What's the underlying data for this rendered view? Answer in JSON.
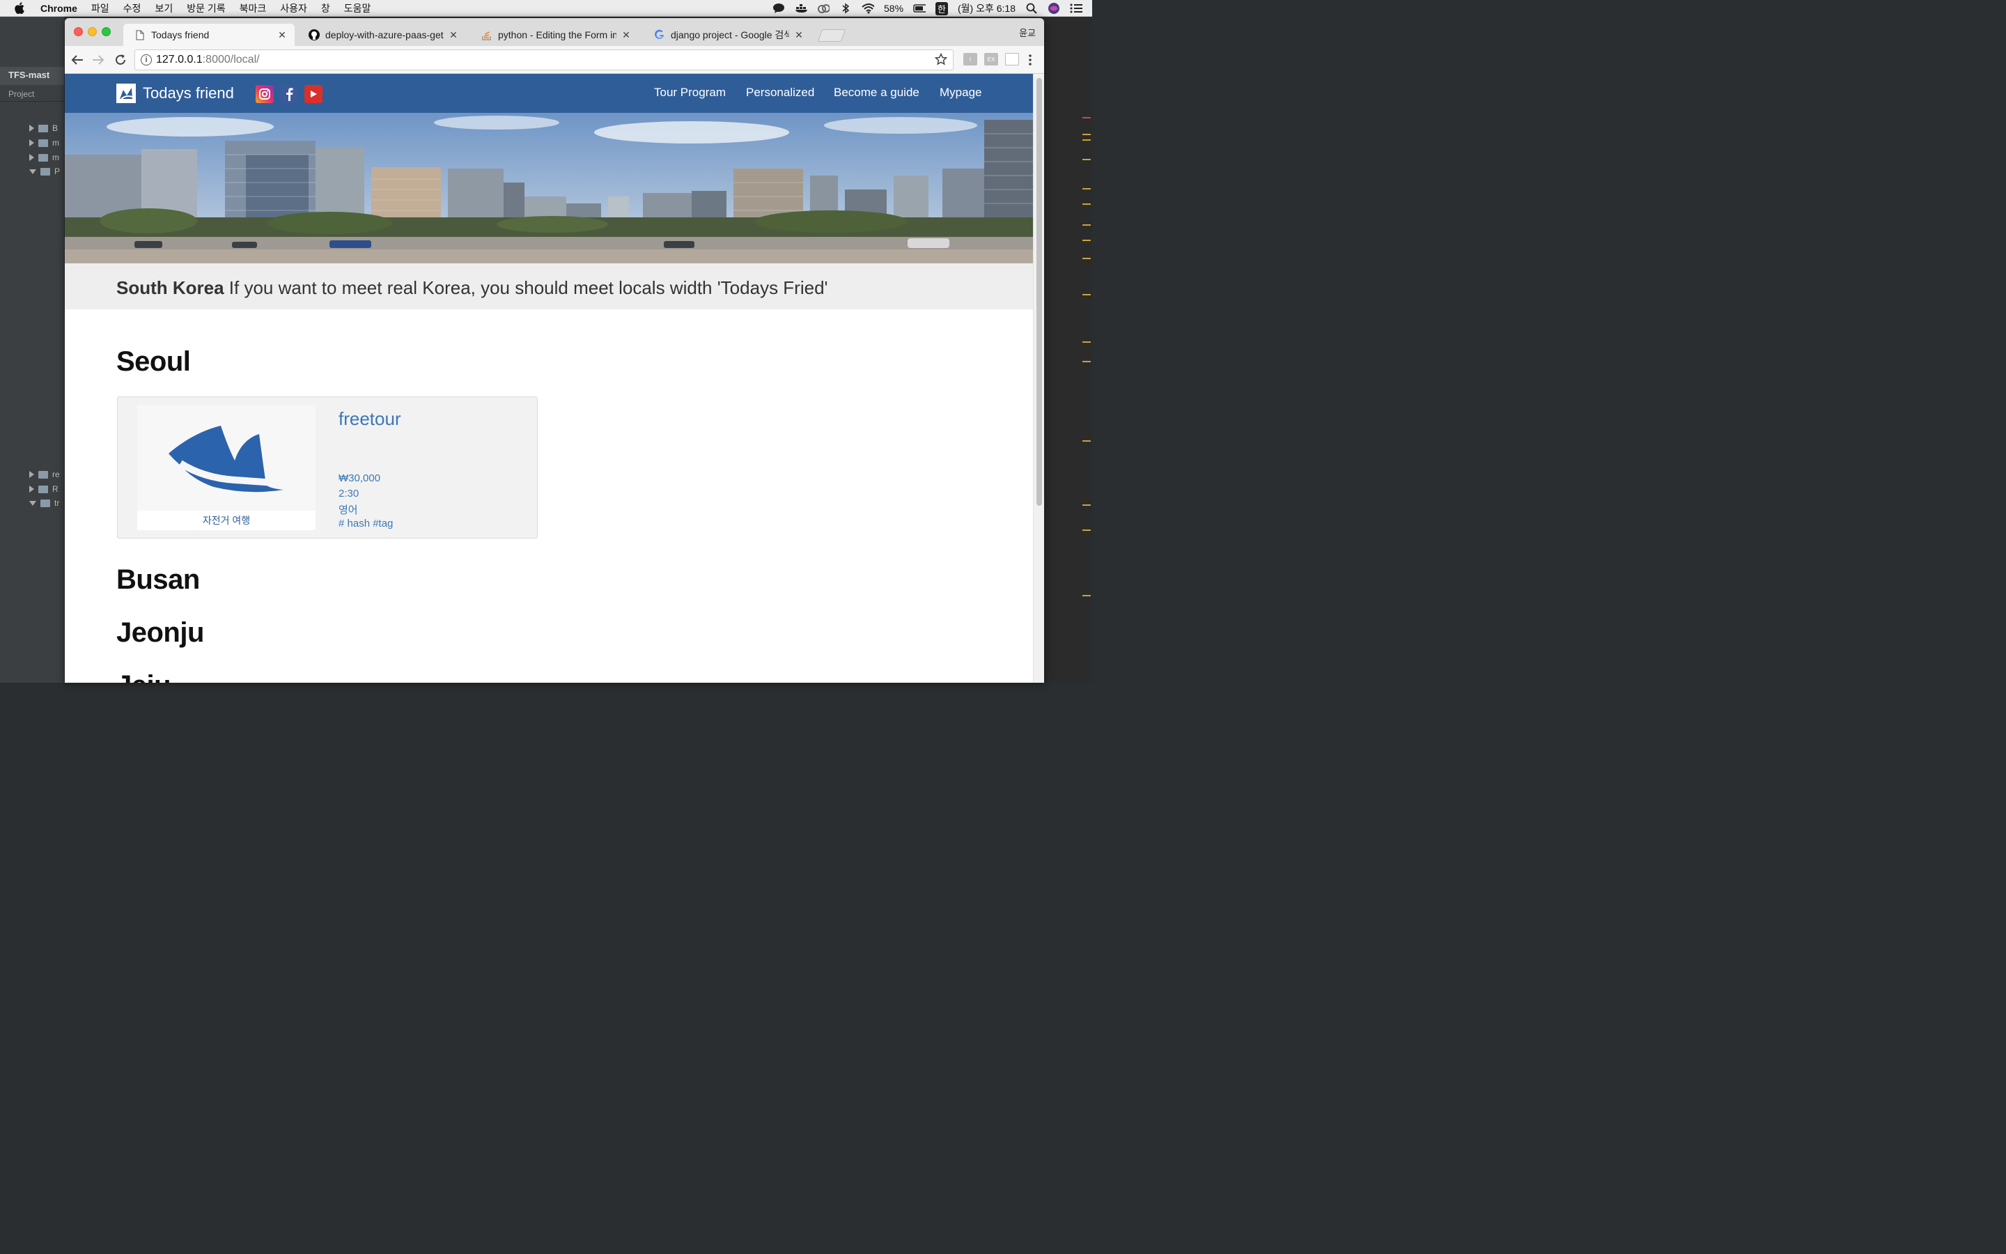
{
  "menubar": {
    "app_name": "Chrome",
    "items": [
      "파일",
      "수정",
      "보기",
      "방문 기록",
      "북마크",
      "사용자",
      "창",
      "도움말"
    ],
    "battery_percent": "58%",
    "input_method": "한",
    "datetime": "(월) 오후 6:18"
  },
  "ide": {
    "project_title": "TFS-mast",
    "project_label": "Project",
    "tree_labels": [
      "B",
      "m",
      "m",
      "P",
      "re",
      "R",
      "tr"
    ]
  },
  "browser": {
    "profile_name": "윤교",
    "tabs": [
      {
        "title": "Todays friend",
        "favicon": "page-icon",
        "active": true
      },
      {
        "title": "deploy-with-azure-paas-get-s",
        "favicon": "github-icon",
        "active": false
      },
      {
        "title": "python - Editing the Form in Dj",
        "favicon": "stackoverflow-icon",
        "active": false
      },
      {
        "title": "django project - Google 검색",
        "favicon": "google-icon",
        "active": false
      }
    ],
    "url_host": "127.0.0.1",
    "url_rest": ":8000/local/",
    "scroll_position_fraction": 0.0
  },
  "site": {
    "brand": "Todays friend",
    "social": [
      "instagram-icon",
      "facebook-icon",
      "youtube-icon"
    ],
    "nav": [
      "Tour Program",
      "Personalized",
      "Become a guide",
      "Mypage"
    ],
    "banner_bold": "South Korea",
    "banner_rest": " If you want to meet real Korea, you should meet locals width 'Todays Fried'",
    "colors": {
      "navbar": "#2f5d98",
      "link": "#3b78b5",
      "banner_bg": "#eeeeee"
    }
  },
  "cities": [
    "Seoul",
    "Busan",
    "Jeonju",
    "Jeju"
  ],
  "tour": {
    "title": "freetour",
    "thumbnail_caption": "자전거 여행",
    "price": "₩30,000",
    "duration": "2:30",
    "language": "영어",
    "tags": "# hash #tag"
  }
}
